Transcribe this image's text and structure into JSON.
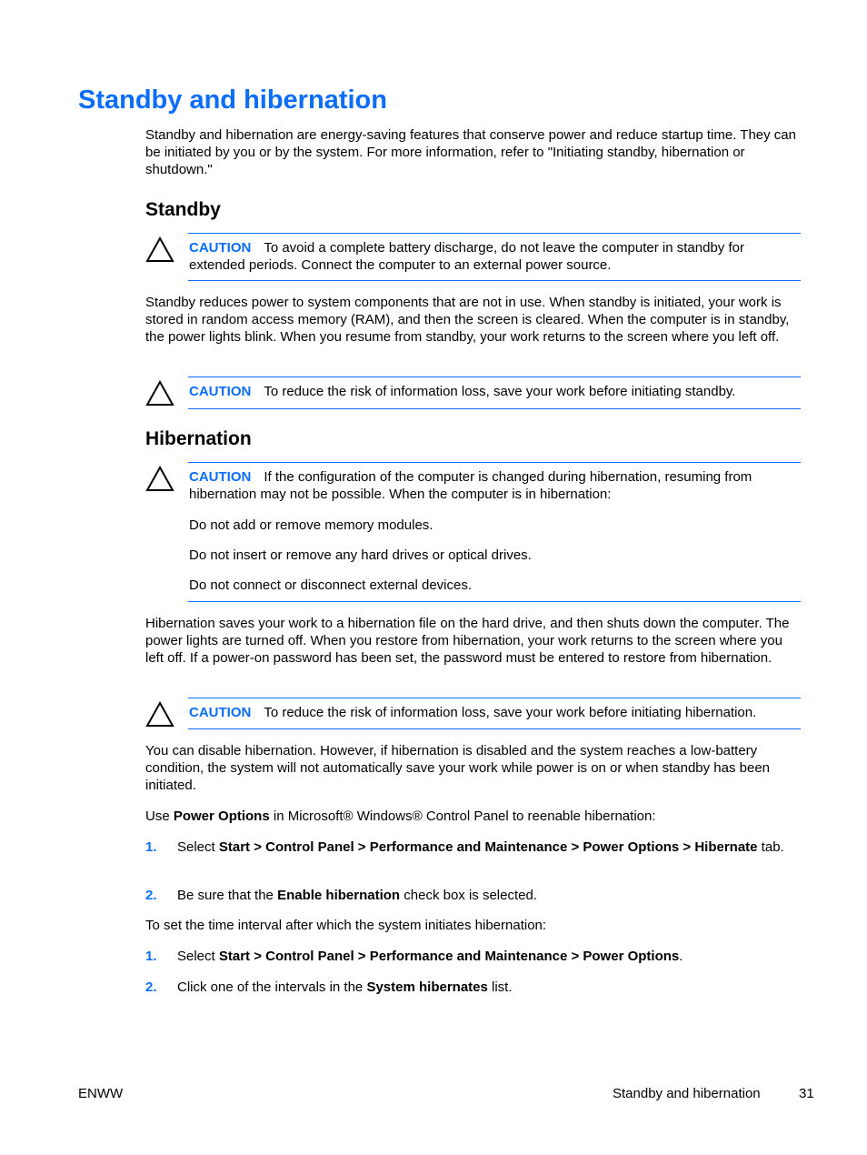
{
  "title": "Standby and hibernation",
  "intro": "Standby and hibernation are energy-saving features that conserve power and reduce startup time. They can be initiated by you or by the system. For more information, refer to \"Initiating standby, hibernation or shutdown.\"",
  "standby": {
    "heading": "Standby",
    "caution1": {
      "label": "CAUTION",
      "text": "To avoid a complete battery discharge, do not leave the computer in standby for extended periods. Connect the computer to an external power source."
    },
    "body": "Standby reduces power to system components that are not in use. When standby is initiated, your work is stored in random access memory (RAM), and then the screen is cleared. When the computer is in standby, the power lights blink. When you resume from standby, your work returns to the screen where you left off.",
    "caution2": {
      "label": "CAUTION",
      "text": "To reduce the risk of information loss, save your work before initiating standby."
    }
  },
  "hibernation": {
    "heading": "Hibernation",
    "caution1": {
      "label": "CAUTION",
      "text": "If the configuration of the computer is changed during hibernation, resuming from hibernation may not be possible. When the computer is in hibernation:",
      "items": [
        "Do not add or remove memory modules.",
        "Do not insert or remove any hard drives or optical drives.",
        "Do not connect or disconnect external devices."
      ]
    },
    "body": "Hibernation saves your work to a hibernation file on the hard drive, and then shuts down the computer. The power lights are turned off. When you restore from hibernation, your work returns to the screen where you left off. If a power-on password has been set, the password must be entered to restore from hibernation.",
    "caution2": {
      "label": "CAUTION",
      "text": "To reduce the risk of information loss, save your work before initiating hibernation."
    },
    "disable_text": "You can disable hibernation. However, if hibernation is disabled and the system reaches a low-battery condition, the system will not automatically save your work while power is on or when standby has been initiated.",
    "reenable_pre": "Use ",
    "reenable_bold": "Power Options",
    "reenable_post": " in Microsoft® Windows® Control Panel to reenable hibernation:",
    "reenable_steps": [
      {
        "num": "1.",
        "pre": "Select ",
        "bold": "Start > Control Panel > Performance and Maintenance > Power Options > Hibernate",
        "post": " tab."
      },
      {
        "num": "2.",
        "pre": "Be sure that the ",
        "bold": "Enable hibernation",
        "post": " check box is selected."
      }
    ],
    "interval_text": "To set the time interval after which the system initiates hibernation:",
    "interval_steps": [
      {
        "num": "1.",
        "pre": "Select ",
        "bold": "Start > Control Panel > Performance and Maintenance > Power Options",
        "post": "."
      },
      {
        "num": "2.",
        "pre": "Click one of the intervals in the ",
        "bold": "System hibernates",
        "post": " list."
      }
    ]
  },
  "footer": {
    "left": "ENWW",
    "section": "Standby and hibernation",
    "page": "31"
  }
}
